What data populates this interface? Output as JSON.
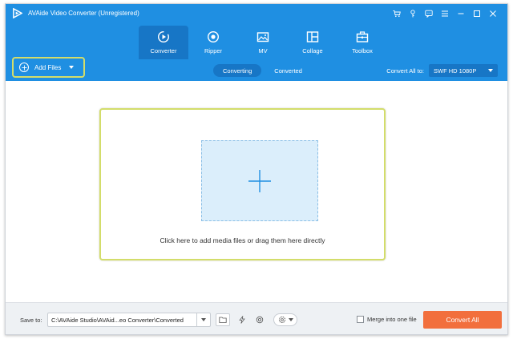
{
  "window": {
    "title": "AVAide Video Converter (Unregistered)",
    "controls": [
      "cart-icon",
      "key-icon",
      "feedback-icon",
      "menu-icon",
      "minimize-icon",
      "maximize-icon",
      "close-icon"
    ]
  },
  "nav": {
    "tabs": [
      {
        "label": "Converter",
        "icon": "converter-icon",
        "active": true
      },
      {
        "label": "Ripper",
        "icon": "ripper-icon",
        "active": false
      },
      {
        "label": "MV",
        "icon": "mv-icon",
        "active": false
      },
      {
        "label": "Collage",
        "icon": "collage-icon",
        "active": false
      },
      {
        "label": "Toolbox",
        "icon": "toolbox-icon",
        "active": false
      }
    ]
  },
  "toolbar": {
    "add_files_label": "Add Files",
    "segments": [
      {
        "label": "Converting",
        "active": true
      },
      {
        "label": "Converted",
        "active": false
      }
    ],
    "convert_all_label": "Convert All to:",
    "format_value": "SWF HD 1080P"
  },
  "dropzone": {
    "hint": "Click here to add media files or drag them here directly"
  },
  "bottom": {
    "save_to_label": "Save to:",
    "path_value": "C:\\AVAide Studio\\AVAid...eo Converter\\Converted",
    "merge_label": "Merge into one file",
    "convert_button": "Convert All"
  },
  "colors": {
    "header_blue": "#1f8fe2",
    "active_tab": "#1776c6",
    "highlight": "#d3dd6a",
    "convert_orange": "#f26f3d",
    "drop_fill": "#dbeefb"
  }
}
